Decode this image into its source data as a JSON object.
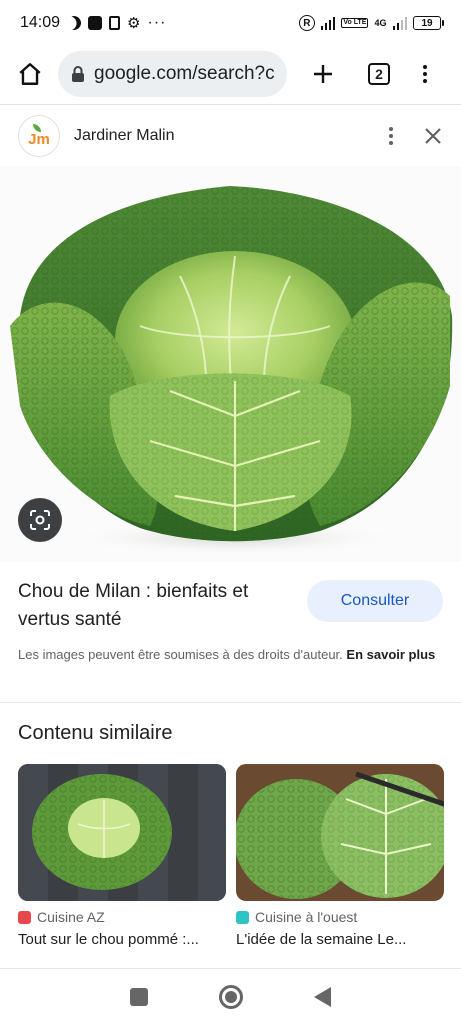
{
  "status_bar": {
    "time": "14:09",
    "battery": "19",
    "network": "4G",
    "volte": "Vo LTE"
  },
  "browser": {
    "url": "google.com/search?c",
    "tab_count": "2"
  },
  "source": {
    "name": "Jardiner Malin",
    "logo_text": "Jm"
  },
  "result": {
    "title": "Chou de Milan : bienfaits et vertus santé",
    "consult_label": "Consulter",
    "copyright_text": "Les images peuvent être soumises à des droits d'auteur.",
    "learn_more": "En savoir plus"
  },
  "similar": {
    "heading": "Contenu similaire",
    "items": [
      {
        "source": "Cuisine AZ",
        "caption": "Tout sur le chou pommé :...",
        "favicon_color": "#e5484d"
      },
      {
        "source": "Cuisine à l'ouest",
        "caption": "L'idée de la semaine Le...",
        "favicon_color": "#2ec4c4"
      }
    ]
  },
  "colors": {
    "accent": "#1a56c4",
    "button_bg": "#e8f0fe",
    "cabbage_dark": "#3e7a2c",
    "cabbage_light": "#a7cf63"
  }
}
